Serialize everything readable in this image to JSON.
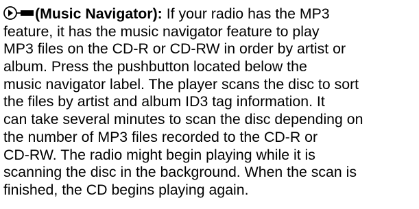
{
  "icons": {
    "first": "music-navigator-icon"
  },
  "paragraph": {
    "heading": "(Music Navigator):",
    "first_line_rest": " If your radio has the MP3",
    "lines": [
      "feature, it has the music navigator feature to play",
      "MP3 files on the CD-R or CD-RW in order by artist or",
      "album. Press the pushbutton located below the",
      "music navigator label. The player scans the disc to sort",
      "the files by artist and album ID3 tag information. It",
      "can take several minutes to scan the disc depending on",
      "the number of MP3 files recorded to the CD-R or",
      "CD-RW. The radio might begin playing while it is",
      "scanning the disc in the background. When the scan is",
      "finished, the CD begins playing again."
    ]
  }
}
